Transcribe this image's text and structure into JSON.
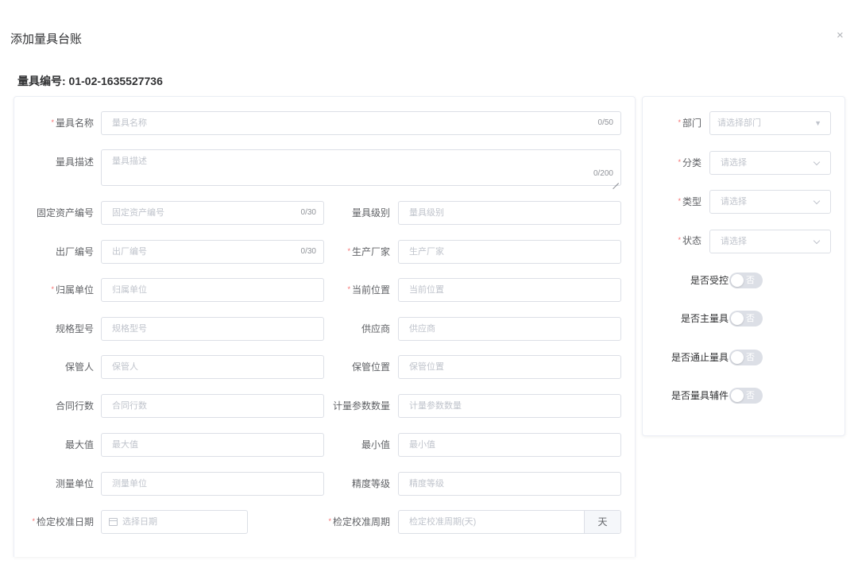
{
  "dialog": {
    "title": "添加量具台账",
    "close": "×",
    "code_line": "量具编号: 01-02-1635527736"
  },
  "required_mark": "*",
  "form": {
    "name": {
      "label": "量具名称",
      "placeholder": "量具名称",
      "counter": "0/50",
      "required": true
    },
    "description": {
      "label": "量具描述",
      "placeholder": "量具描述",
      "counter": "0/200",
      "required": false
    },
    "fixed_asset_no": {
      "label": "固定资产编号",
      "placeholder": "固定资产编号",
      "counter": "0/30",
      "required": false
    },
    "level": {
      "label": "量具级别",
      "placeholder": "量具级别",
      "required": false
    },
    "factory_no": {
      "label": "出厂编号",
      "placeholder": "出厂编号",
      "counter": "0/30",
      "required": false
    },
    "manufacturer": {
      "label": "生产厂家",
      "placeholder": "生产厂家",
      "required": true
    },
    "owner_unit": {
      "label": "归属单位",
      "placeholder": "归属单位",
      "required": true
    },
    "current_location": {
      "label": "当前位置",
      "placeholder": "当前位置",
      "required": true
    },
    "spec_model": {
      "label": "规格型号",
      "placeholder": "规格型号",
      "required": false
    },
    "supplier": {
      "label": "供应商",
      "placeholder": "供应商",
      "required": false
    },
    "custodian": {
      "label": "保管人",
      "placeholder": "保管人",
      "required": false
    },
    "storage_location": {
      "label": "保管位置",
      "placeholder": "保管位置",
      "required": false
    },
    "contract_rows": {
      "label": "合同行数",
      "placeholder": "合同行数",
      "required": false
    },
    "param_count": {
      "label": "计量参数数量",
      "placeholder": "计量参数数量",
      "required": false
    },
    "max_value": {
      "label": "最大值",
      "placeholder": "最大值",
      "required": false
    },
    "min_value": {
      "label": "最小值",
      "placeholder": "最小值",
      "required": false
    },
    "unit": {
      "label": "测量单位",
      "placeholder": "测量单位",
      "required": false
    },
    "accuracy": {
      "label": "精度等级",
      "placeholder": "精度等级",
      "required": false
    },
    "calib_date": {
      "label": "检定校准日期",
      "placeholder": "选择日期",
      "required": true
    },
    "calib_period": {
      "label": "检定校准周期",
      "placeholder": "检定校准周期(天)",
      "append": "天",
      "required": true
    }
  },
  "side": {
    "department": {
      "label": "部门",
      "placeholder": "请选择部门",
      "required": true,
      "arrow": "▼"
    },
    "category": {
      "label": "分类",
      "placeholder": "请选择",
      "required": true
    },
    "type": {
      "label": "类型",
      "placeholder": "请选择",
      "required": true
    },
    "status": {
      "label": "状态",
      "placeholder": "请选择",
      "required": true
    },
    "switches": [
      {
        "label": "是否受控",
        "text": "否",
        "on": false
      },
      {
        "label": "是否主量具",
        "text": "否",
        "on": false
      },
      {
        "label": "是否通止量具",
        "text": "否",
        "on": false
      },
      {
        "label": "是否量具辅件",
        "text": "否",
        "on": false
      }
    ]
  }
}
